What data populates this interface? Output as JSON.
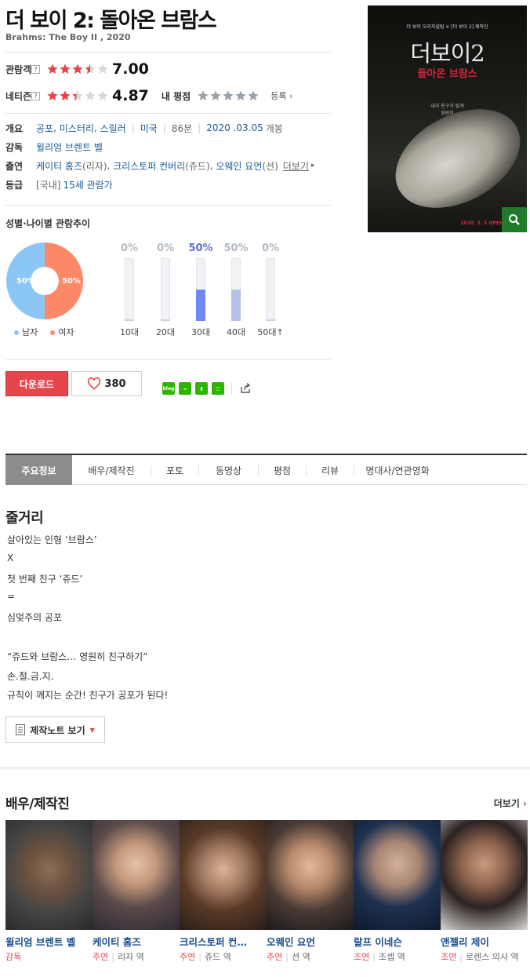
{
  "movie": {
    "title": "더 보이 2: 돌아온 브람스",
    "subtitle": "Brahms: The Boy  II , 2020"
  },
  "ratings": {
    "audience_label": "관람객",
    "audience_score": "7.00",
    "audience_stars": 3.5,
    "netizen_label": "네티즌",
    "netizen_score": "4.87",
    "netizen_stars": 2.4,
    "my_label": "내 평점",
    "register": "등록",
    "q": "?"
  },
  "info": {
    "overview_label": "개요",
    "genres": [
      "공포",
      "미스터리",
      "스릴러"
    ],
    "country": "미국",
    "runtime": "86분",
    "release_date": "2020 .03.05",
    "release_suffix": "개봉",
    "director_label": "감독",
    "director": "윌리엄 브렌트 벨",
    "cast_label": "출연",
    "cast": [
      {
        "name": "케이티 홈즈",
        "role": "(리자)"
      },
      {
        "name": "크리스토퍼 컨버리",
        "role": "(쥬드)"
      },
      {
        "name": "오웨인 요먼",
        "role": "(션)"
      }
    ],
    "cast_more": "더보기",
    "grade_label": "등급",
    "grade_prefix": "[국내]",
    "grade": "15세 관람가"
  },
  "poster": {
    "top": "더 보이 오리지널팀 × [더 보이 2] 제작진",
    "title": "더보이2",
    "subtitle": "돌아온 브람스",
    "tagline": "내가 친구가 될게\n영원히",
    "date": "2020. 3. 5 OPEN"
  },
  "demographics": {
    "title": "성별·나이별 관람추이",
    "male_pct": 50,
    "female_pct": 50,
    "male_label": "남자",
    "female_label": "여자",
    "male_text": "50%",
    "female_text": "50%",
    "ages": [
      {
        "label": "10대",
        "pct": "0%",
        "value": 0
      },
      {
        "label": "20대",
        "pct": "0%",
        "value": 0
      },
      {
        "label": "30대",
        "pct": "50%",
        "value": 50
      },
      {
        "label": "40대",
        "pct": "50%",
        "value": 50
      },
      {
        "label": "50대↑",
        "pct": "0%",
        "value": 0
      }
    ],
    "colors": {
      "male": "#8cc6f5",
      "female": "#fb8968",
      "age_high": "#6d8af0",
      "age_mid": "#b4c1e8"
    }
  },
  "actions": {
    "download": "다운로드",
    "likes": "380",
    "share_icons": [
      "blog",
      "cafe",
      "bookmark",
      "line"
    ]
  },
  "tabs": [
    "주요정보",
    "배우/제작진",
    "포토",
    "동영상",
    "평점",
    "리뷰",
    "명대사/연관영화"
  ],
  "synopsis": {
    "title": "줄거리",
    "lines": [
      "살아있는 인형 ‘브람스’",
      " X",
      "첫 번째 친구 ‘쥬드’",
      "=",
      "심멎주의 공포",
      "",
      "“쥬드와 브람스… 영원히 친구하기”",
      "손.절.금.지.",
      "규칙이 깨지는 순간! 친구가 공포가 된다!"
    ],
    "note_button": "제작노트 보기"
  },
  "cast_section": {
    "title": "배우/제작진",
    "more": "더보기",
    "people": [
      {
        "name": "윌리엄 브렌트 벨",
        "type": "감독",
        "role": ""
      },
      {
        "name": "케이티 홈즈",
        "type": "주연",
        "role": "리자 역"
      },
      {
        "name": "크리스토퍼 컨…",
        "type": "주연",
        "role": "쥬드 역"
      },
      {
        "name": "오웨인 요먼",
        "type": "주연",
        "role": "션 역"
      },
      {
        "name": "랄프 이네슨",
        "type": "조연",
        "role": "조셉 역"
      },
      {
        "name": "앤젤리 제이",
        "type": "조연",
        "role": "로렌스 의사 역"
      }
    ]
  }
}
